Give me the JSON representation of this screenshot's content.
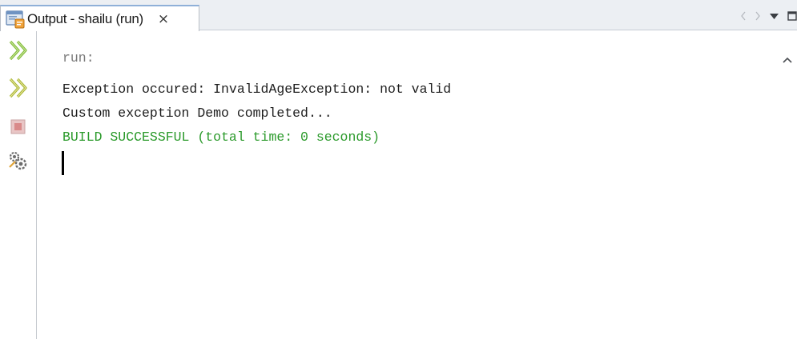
{
  "tab": {
    "title": "Output - shailu (run)",
    "close_label": "×",
    "icon": "output-window-icon"
  },
  "window_controls": {
    "items": [
      "scroll-tabs-left-icon",
      "scroll-tabs-right-icon",
      "tab-list-dropdown-icon",
      "maximize-icon"
    ]
  },
  "toolbar": {
    "items": [
      "rerun-icon",
      "rerun-with-options-icon",
      "stop-icon",
      "run-settings-icon"
    ]
  },
  "output": {
    "run_line": "run:",
    "lines": [
      "Exception occured: InvalidAgeException: not valid",
      "Custom exception Demo completed..."
    ],
    "build_line": "BUILD SUCCESSFUL (total time: 0 seconds)"
  },
  "colors": {
    "run_text": "#7a7a7a",
    "normal_text": "#1e1e1e",
    "success_text": "#2b9a2b",
    "rerun_icon": "#7fba35",
    "stop_icon": "#d98a8a"
  }
}
